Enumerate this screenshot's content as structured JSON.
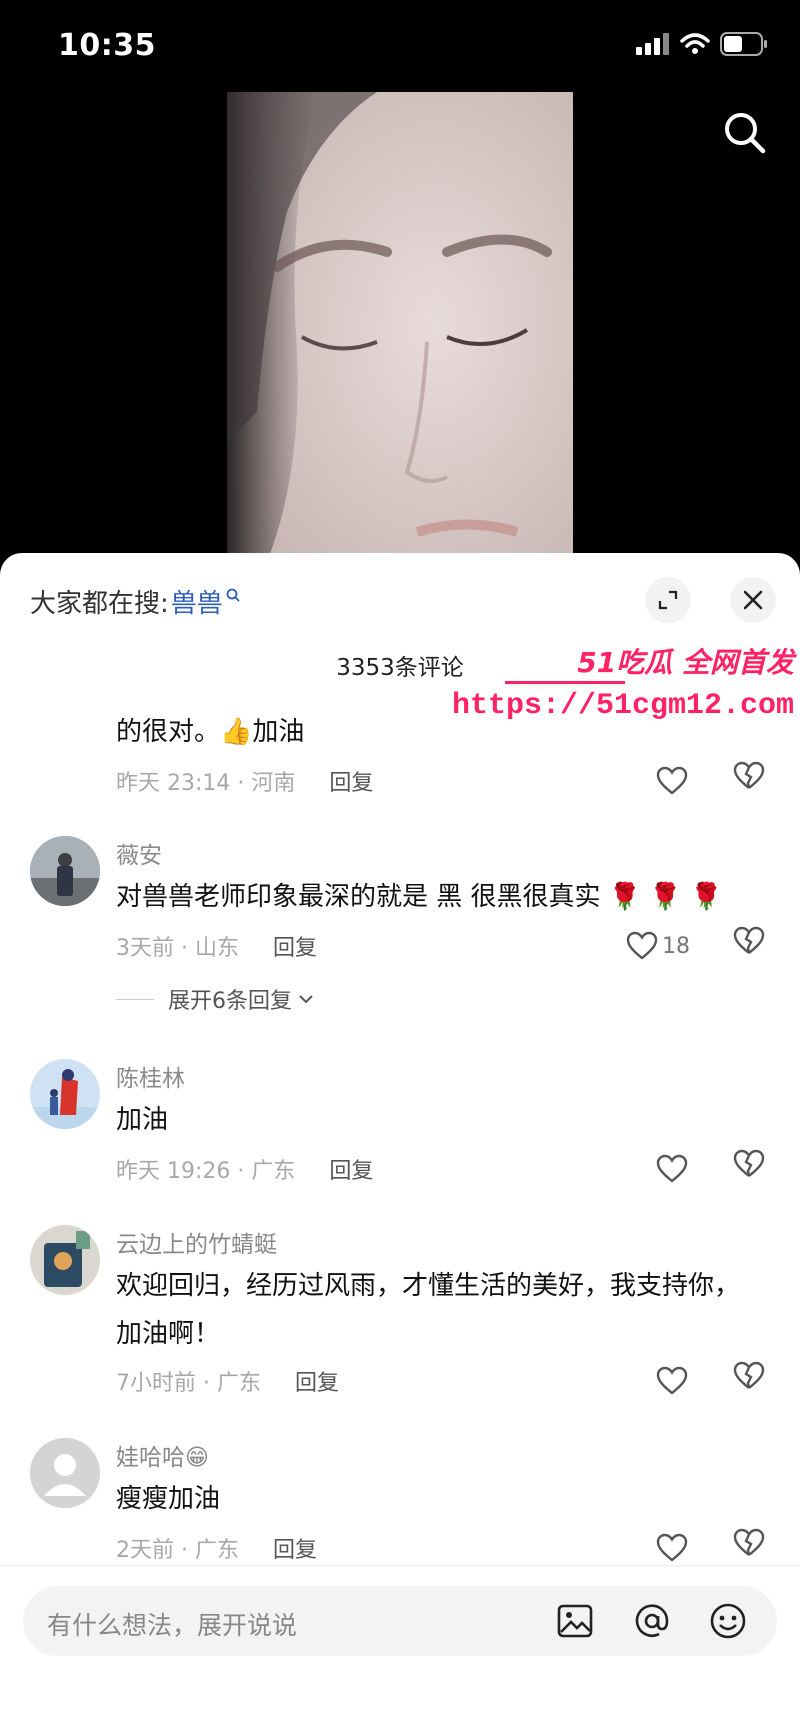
{
  "status": {
    "time": "10:35"
  },
  "header": {
    "search_prefix": "大家都在搜:",
    "search_term": "兽兽",
    "comment_count": "3353条评论"
  },
  "watermark": {
    "line1": "51吃瓜 全网首发",
    "line2": "https://51cgm12.com"
  },
  "comments": [
    {
      "text": "的很对。👍加油",
      "time": "昨天 23:14 · 河南",
      "reply": "回复"
    },
    {
      "name": "薇安",
      "text": "对兽兽老师印象最深的就是 黑 很黑很真实 🌹 🌹 🌹",
      "time": "3天前 · 山东",
      "reply": "回复",
      "likes": "18",
      "expand": "展开6条回复"
    },
    {
      "name": "陈桂林",
      "text": "加油",
      "time": "昨天 19:26 · 广东",
      "reply": "回复"
    },
    {
      "name": "云边上的竹蜻蜓",
      "text": "欢迎回归，经历过风雨，才懂生活的美好，我支持你，加油啊！",
      "time": "7小时前 · 广东",
      "reply": "回复"
    },
    {
      "name": "娃哈哈😁",
      "text": "瘦瘦加油",
      "time": "2天前 · 广东",
      "reply": "回复"
    }
  ],
  "input": {
    "placeholder": "有什么想法，展开说说"
  },
  "icons": {
    "search": "search-icon",
    "expand": "expand-icon",
    "close": "close-icon",
    "like": "heart-icon",
    "dislike": "broken-heart-icon",
    "image": "image-icon",
    "mention": "at-icon",
    "emoji": "emoji-icon"
  },
  "colors": {
    "accent_link": "#2d5cbf",
    "watermark": "#ff2366"
  }
}
